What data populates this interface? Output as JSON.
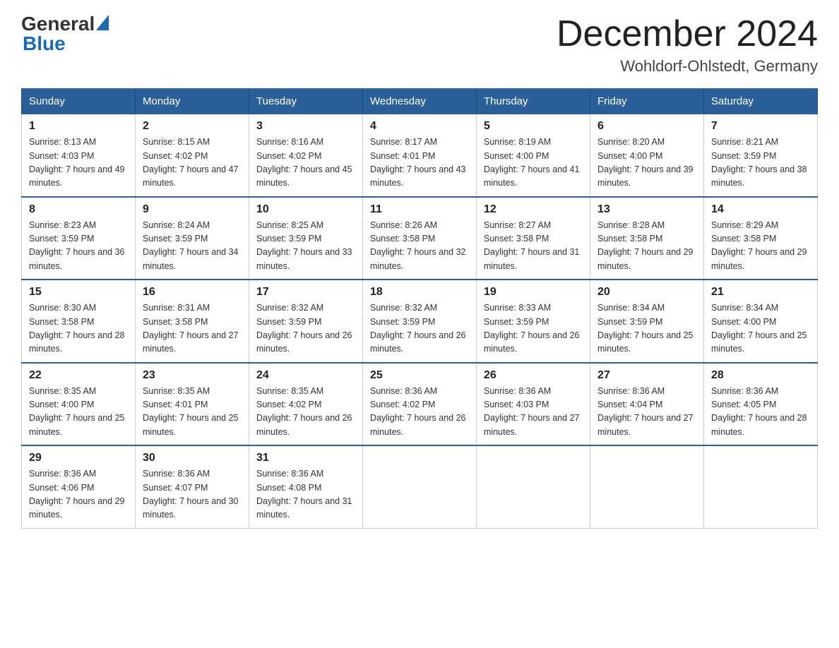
{
  "header": {
    "logo_general": "General",
    "logo_blue": "Blue",
    "month_title": "December 2024",
    "location": "Wohldorf-Ohlstedt, Germany"
  },
  "weekdays": [
    "Sunday",
    "Monday",
    "Tuesday",
    "Wednesday",
    "Thursday",
    "Friday",
    "Saturday"
  ],
  "weeks": [
    [
      {
        "day": "1",
        "sunrise": "8:13 AM",
        "sunset": "4:03 PM",
        "daylight": "7 hours and 49 minutes."
      },
      {
        "day": "2",
        "sunrise": "8:15 AM",
        "sunset": "4:02 PM",
        "daylight": "7 hours and 47 minutes."
      },
      {
        "day": "3",
        "sunrise": "8:16 AM",
        "sunset": "4:02 PM",
        "daylight": "7 hours and 45 minutes."
      },
      {
        "day": "4",
        "sunrise": "8:17 AM",
        "sunset": "4:01 PM",
        "daylight": "7 hours and 43 minutes."
      },
      {
        "day": "5",
        "sunrise": "8:19 AM",
        "sunset": "4:00 PM",
        "daylight": "7 hours and 41 minutes."
      },
      {
        "day": "6",
        "sunrise": "8:20 AM",
        "sunset": "4:00 PM",
        "daylight": "7 hours and 39 minutes."
      },
      {
        "day": "7",
        "sunrise": "8:21 AM",
        "sunset": "3:59 PM",
        "daylight": "7 hours and 38 minutes."
      }
    ],
    [
      {
        "day": "8",
        "sunrise": "8:23 AM",
        "sunset": "3:59 PM",
        "daylight": "7 hours and 36 minutes."
      },
      {
        "day": "9",
        "sunrise": "8:24 AM",
        "sunset": "3:59 PM",
        "daylight": "7 hours and 34 minutes."
      },
      {
        "day": "10",
        "sunrise": "8:25 AM",
        "sunset": "3:59 PM",
        "daylight": "7 hours and 33 minutes."
      },
      {
        "day": "11",
        "sunrise": "8:26 AM",
        "sunset": "3:58 PM",
        "daylight": "7 hours and 32 minutes."
      },
      {
        "day": "12",
        "sunrise": "8:27 AM",
        "sunset": "3:58 PM",
        "daylight": "7 hours and 31 minutes."
      },
      {
        "day": "13",
        "sunrise": "8:28 AM",
        "sunset": "3:58 PM",
        "daylight": "7 hours and 29 minutes."
      },
      {
        "day": "14",
        "sunrise": "8:29 AM",
        "sunset": "3:58 PM",
        "daylight": "7 hours and 29 minutes."
      }
    ],
    [
      {
        "day": "15",
        "sunrise": "8:30 AM",
        "sunset": "3:58 PM",
        "daylight": "7 hours and 28 minutes."
      },
      {
        "day": "16",
        "sunrise": "8:31 AM",
        "sunset": "3:58 PM",
        "daylight": "7 hours and 27 minutes."
      },
      {
        "day": "17",
        "sunrise": "8:32 AM",
        "sunset": "3:59 PM",
        "daylight": "7 hours and 26 minutes."
      },
      {
        "day": "18",
        "sunrise": "8:32 AM",
        "sunset": "3:59 PM",
        "daylight": "7 hours and 26 minutes."
      },
      {
        "day": "19",
        "sunrise": "8:33 AM",
        "sunset": "3:59 PM",
        "daylight": "7 hours and 26 minutes."
      },
      {
        "day": "20",
        "sunrise": "8:34 AM",
        "sunset": "3:59 PM",
        "daylight": "7 hours and 25 minutes."
      },
      {
        "day": "21",
        "sunrise": "8:34 AM",
        "sunset": "4:00 PM",
        "daylight": "7 hours and 25 minutes."
      }
    ],
    [
      {
        "day": "22",
        "sunrise": "8:35 AM",
        "sunset": "4:00 PM",
        "daylight": "7 hours and 25 minutes."
      },
      {
        "day": "23",
        "sunrise": "8:35 AM",
        "sunset": "4:01 PM",
        "daylight": "7 hours and 25 minutes."
      },
      {
        "day": "24",
        "sunrise": "8:35 AM",
        "sunset": "4:02 PM",
        "daylight": "7 hours and 26 minutes."
      },
      {
        "day": "25",
        "sunrise": "8:36 AM",
        "sunset": "4:02 PM",
        "daylight": "7 hours and 26 minutes."
      },
      {
        "day": "26",
        "sunrise": "8:36 AM",
        "sunset": "4:03 PM",
        "daylight": "7 hours and 27 minutes."
      },
      {
        "day": "27",
        "sunrise": "8:36 AM",
        "sunset": "4:04 PM",
        "daylight": "7 hours and 27 minutes."
      },
      {
        "day": "28",
        "sunrise": "8:36 AM",
        "sunset": "4:05 PM",
        "daylight": "7 hours and 28 minutes."
      }
    ],
    [
      {
        "day": "29",
        "sunrise": "8:36 AM",
        "sunset": "4:06 PM",
        "daylight": "7 hours and 29 minutes."
      },
      {
        "day": "30",
        "sunrise": "8:36 AM",
        "sunset": "4:07 PM",
        "daylight": "7 hours and 30 minutes."
      },
      {
        "day": "31",
        "sunrise": "8:36 AM",
        "sunset": "4:08 PM",
        "daylight": "7 hours and 31 minutes."
      },
      null,
      null,
      null,
      null
    ]
  ]
}
